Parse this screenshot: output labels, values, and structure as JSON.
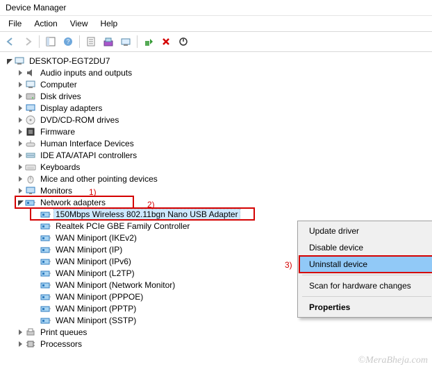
{
  "window_title": "Device Manager",
  "menus": [
    "File",
    "Action",
    "View",
    "Help"
  ],
  "root": "DESKTOP-EGT2DU7",
  "categories": [
    {
      "label": "Audio inputs and outputs",
      "icon": "audio"
    },
    {
      "label": "Computer",
      "icon": "computer"
    },
    {
      "label": "Disk drives",
      "icon": "disk"
    },
    {
      "label": "Display adapters",
      "icon": "display"
    },
    {
      "label": "DVD/CD-ROM drives",
      "icon": "dvd"
    },
    {
      "label": "Firmware",
      "icon": "firmware"
    },
    {
      "label": "Human Interface Devices",
      "icon": "hid"
    },
    {
      "label": "IDE ATA/ATAPI controllers",
      "icon": "ide"
    },
    {
      "label": "Keyboards",
      "icon": "keyboard"
    },
    {
      "label": "Mice and other pointing devices",
      "icon": "mouse"
    },
    {
      "label": "Monitors",
      "icon": "monitor"
    }
  ],
  "network_adapters_label": "Network adapters",
  "network_adapters": [
    {
      "label": "150Mbps Wireless 802.11bgn Nano USB Adapter"
    },
    {
      "label": "Realtek PCIe GBE Family Controller"
    },
    {
      "label": "WAN Miniport (IKEv2)"
    },
    {
      "label": "WAN Miniport (IP)"
    },
    {
      "label": "WAN Miniport (IPv6)"
    },
    {
      "label": "WAN Miniport (L2TP)"
    },
    {
      "label": "WAN Miniport (Network Monitor)"
    },
    {
      "label": "WAN Miniport (PPPOE)"
    },
    {
      "label": "WAN Miniport (PPTP)"
    },
    {
      "label": "WAN Miniport (SSTP)"
    }
  ],
  "after_network": [
    {
      "label": "Print queues",
      "icon": "print"
    },
    {
      "label": "Processors",
      "icon": "cpu"
    }
  ],
  "context_menu": {
    "update": "Update driver",
    "disable": "Disable device",
    "uninstall": "Uninstall device",
    "scan": "Scan for hardware changes",
    "properties": "Properties"
  },
  "annotations": {
    "a1": "1)",
    "a2": "2)",
    "a3": "3)"
  },
  "watermark": "©MeraBheja.com"
}
